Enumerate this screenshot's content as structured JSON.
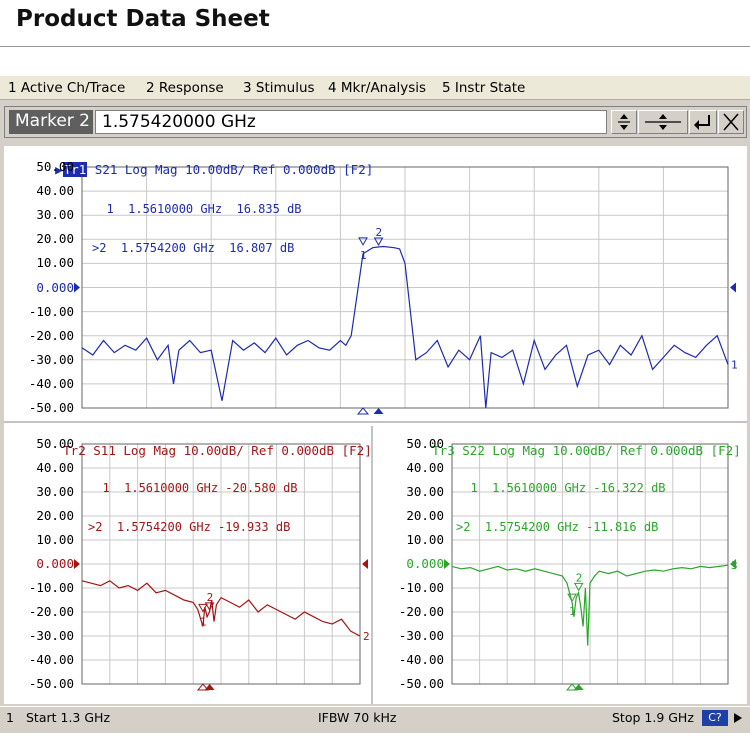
{
  "page": {
    "title": "Product Data Sheet"
  },
  "menu": [
    {
      "label": "1 Active Ch/Trace"
    },
    {
      "label": "2 Response"
    },
    {
      "label": "3 Stimulus"
    },
    {
      "label": "4 Mkr/Analysis"
    },
    {
      "label": "5 Instr State"
    }
  ],
  "entry": {
    "label": "Marker 2",
    "value": "1.575420000 GHz"
  },
  "colors": {
    "tr1": "#1d2bb0",
    "tr2": "#a31515",
    "tr3": "#2aa52a",
    "grid": "#c8c8c8",
    "background": "#ffffff"
  },
  "traces": {
    "tr1": {
      "tag": "Tr1",
      "header": "S21 Log Mag 10.00dB/ Ref 0.000dB [F2]",
      "ref_label": "0.000",
      "y_labels": [
        "50.00",
        "40.00",
        "30.00",
        "20.00",
        "10.00",
        "0.000",
        "-10.00",
        "-20.00",
        "-30.00",
        "-40.00",
        "-50.00"
      ],
      "markers": [
        {
          "line": "  1  1.5610000 GHz  16.835 dB"
        },
        {
          "line": ">2  1.5754200 GHz  16.807 dB"
        }
      ]
    },
    "tr2": {
      "tag": "Tr2",
      "header": "S11 Log Mag 10.00dB/ Ref 0.000dB [F2]",
      "ref_label": "0.000",
      "y_labels": [
        "50.00",
        "40.00",
        "30.00",
        "20.00",
        "10.00",
        "0.000",
        "-10.00",
        "-20.00",
        "-30.00",
        "-40.00",
        "-50.00"
      ],
      "markers": [
        {
          "line": "  1  1.5610000 GHz -20.580 dB"
        },
        {
          "line": ">2  1.5754200 GHz -19.933 dB"
        }
      ]
    },
    "tr3": {
      "tag": "Tr3",
      "header": "S22 Log Mag 10.00dB/ Ref 0.000dB [F2]",
      "ref_label": "0.000",
      "y_labels": [
        "50.00",
        "40.00",
        "30.00",
        "20.00",
        "10.00",
        "0.000",
        "-10.00",
        "-20.00",
        "-30.00",
        "-40.00",
        "-50.00"
      ],
      "markers": [
        {
          "line": "  1  1.5610000 GHz -16.322 dB"
        },
        {
          "line": ">2  1.5754200 GHz -11.816 dB"
        }
      ]
    }
  },
  "status": {
    "channel": "1",
    "start": "Start 1.3 GHz",
    "ifbw": "IFBW 70 kHz",
    "stop": "Stop 1.9 GHz",
    "badge": "C?"
  },
  "chart_data": [
    {
      "type": "line",
      "trace": "Tr1 S21",
      "x_range_ghz": [
        1.3,
        1.9
      ],
      "ylim": [
        -50,
        50
      ],
      "x": [
        1.3,
        1.31,
        1.32,
        1.33,
        1.34,
        1.35,
        1.36,
        1.37,
        1.38,
        1.385,
        1.39,
        1.4,
        1.41,
        1.42,
        1.43,
        1.44,
        1.45,
        1.46,
        1.47,
        1.48,
        1.49,
        1.5,
        1.51,
        1.52,
        1.53,
        1.54,
        1.545,
        1.55,
        1.561,
        1.57,
        1.575,
        1.58,
        1.59,
        1.595,
        1.6,
        1.605,
        1.61,
        1.62,
        1.63,
        1.64,
        1.65,
        1.66,
        1.67,
        1.675,
        1.68,
        1.69,
        1.7,
        1.71,
        1.72,
        1.73,
        1.74,
        1.75,
        1.76,
        1.77,
        1.78,
        1.79,
        1.8,
        1.81,
        1.82,
        1.83,
        1.84,
        1.85,
        1.86,
        1.87,
        1.88,
        1.89,
        1.9
      ],
      "y": [
        -25,
        -28,
        -22,
        -27,
        -24,
        -26,
        -21,
        -30,
        -24,
        -40,
        -26,
        -22,
        -27,
        -26,
        -47,
        -22,
        -26,
        -23,
        -27,
        -21,
        -28,
        -24,
        -22,
        -25,
        -26,
        -22,
        -24,
        -20,
        14,
        16.5,
        16.8,
        17,
        16.5,
        16,
        10,
        -10,
        -30,
        -27,
        -22,
        -33,
        -26,
        -30,
        -20,
        -50,
        -27,
        -29,
        -26,
        -40,
        -22,
        -34,
        -28,
        -24,
        -41,
        -28,
        -26,
        -32,
        -24,
        -28,
        -20,
        -34,
        -29,
        -24,
        -27,
        -29,
        -24,
        -20,
        -32
      ]
    },
    {
      "type": "line",
      "trace": "Tr2 S11",
      "x_range_ghz": [
        1.3,
        1.9
      ],
      "ylim": [
        -50,
        50
      ],
      "x": [
        1.3,
        1.32,
        1.34,
        1.36,
        1.38,
        1.4,
        1.42,
        1.44,
        1.46,
        1.48,
        1.5,
        1.52,
        1.54,
        1.55,
        1.561,
        1.565,
        1.57,
        1.575,
        1.58,
        1.585,
        1.59,
        1.6,
        1.62,
        1.64,
        1.66,
        1.68,
        1.7,
        1.72,
        1.74,
        1.76,
        1.78,
        1.8,
        1.82,
        1.84,
        1.86,
        1.88,
        1.9
      ],
      "y": [
        -7,
        -8,
        -9,
        -7,
        -10,
        -9,
        -11,
        -8,
        -12,
        -11,
        -13,
        -15,
        -16,
        -19,
        -26,
        -18,
        -22,
        -20,
        -15,
        -24,
        -17,
        -14,
        -16,
        -18,
        -15,
        -20,
        -17,
        -19,
        -21,
        -23,
        -20,
        -22,
        -24,
        -25,
        -23,
        -28,
        -30
      ]
    },
    {
      "type": "line",
      "trace": "Tr3 S22",
      "x_range_ghz": [
        1.3,
        1.9
      ],
      "ylim": [
        -50,
        50
      ],
      "x": [
        1.3,
        1.32,
        1.34,
        1.36,
        1.38,
        1.4,
        1.42,
        1.44,
        1.46,
        1.48,
        1.5,
        1.52,
        1.54,
        1.55,
        1.561,
        1.565,
        1.57,
        1.575,
        1.58,
        1.585,
        1.59,
        1.595,
        1.6,
        1.61,
        1.62,
        1.64,
        1.66,
        1.68,
        1.7,
        1.72,
        1.74,
        1.76,
        1.78,
        1.8,
        1.82,
        1.84,
        1.86,
        1.88,
        1.9
      ],
      "y": [
        -1,
        -2,
        -1.5,
        -3,
        -2,
        -1,
        -2.5,
        -2,
        -3,
        -2,
        -3,
        -4,
        -5,
        -8,
        -16,
        -22,
        -14,
        -12,
        -18,
        -26,
        -10,
        -34,
        -8,
        -5,
        -3,
        -4,
        -3,
        -5,
        -4,
        -3,
        -2.5,
        -3,
        -2,
        -1.5,
        -2,
        -1,
        -1.5,
        -1,
        -0.5
      ]
    }
  ]
}
